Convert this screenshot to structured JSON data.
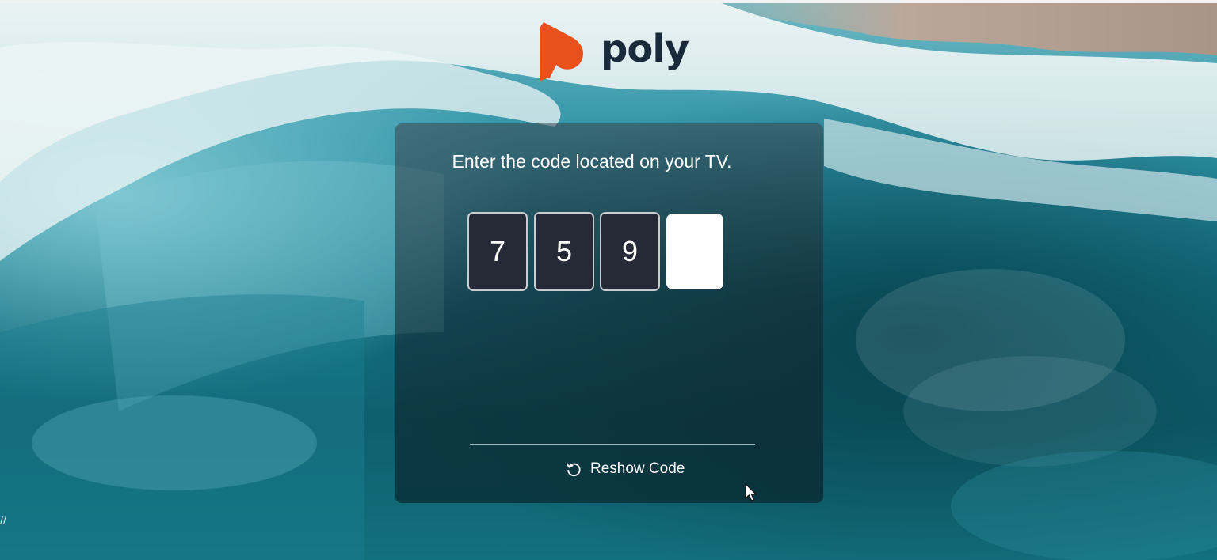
{
  "brand": {
    "name": "poly",
    "color_mark": "#e8501c",
    "color_text": "#1a2a3a"
  },
  "pairing": {
    "prompt": "Enter the code located on your TV.",
    "digits": [
      "7",
      "5",
      "9",
      ""
    ],
    "reshow_label": "Reshow Code"
  },
  "icons": {
    "reshow": "refresh-icon",
    "cursor": "mouse-pointer-icon"
  },
  "corner_mark": "//",
  "colors": {
    "ocean_deep": "#0f5662",
    "ocean_light": "#3fa8b8",
    "foam": "#e9f1f2",
    "sand": "#b9a79b",
    "digit_box": "#252a36"
  }
}
